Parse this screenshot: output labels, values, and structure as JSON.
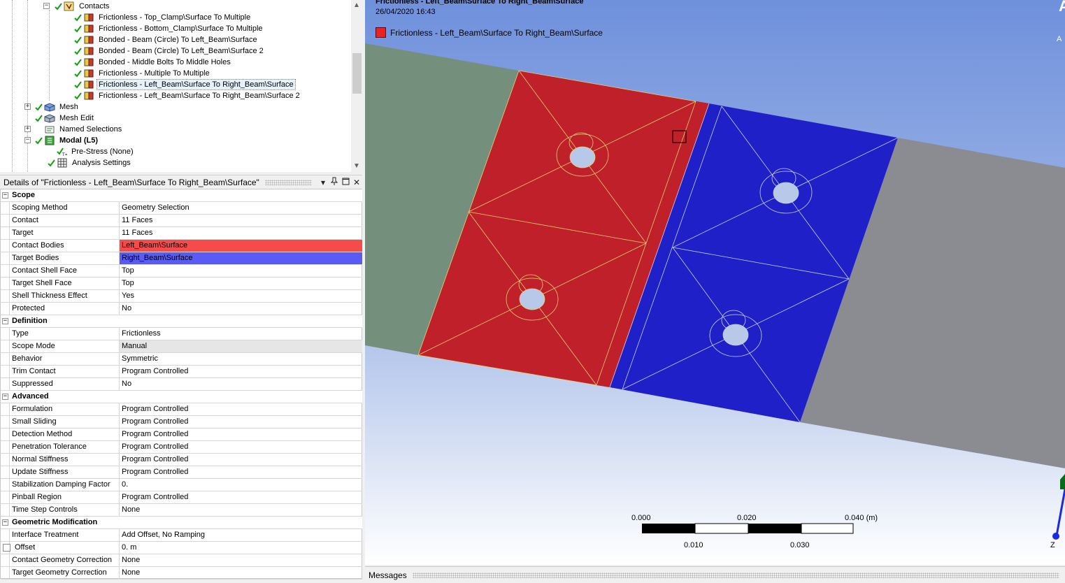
{
  "tree": {
    "items": [
      {
        "label": "Contacts",
        "kind": "folder"
      },
      {
        "label": "Frictionless - Top_Clamp\\Surface To Multiple"
      },
      {
        "label": "Frictionless - Bottom_Clamp\\Surface To Multiple"
      },
      {
        "label": "Bonded - Beam (Circle) To Left_Beam\\Surface"
      },
      {
        "label": "Bonded - Beam (Circle) To Left_Beam\\Surface 2"
      },
      {
        "label": "Bonded - Middle Bolts To Middle Holes"
      },
      {
        "label": "Frictionless - Multiple To Multiple"
      },
      {
        "label": "Frictionless - Left_Beam\\Surface To Right_Beam\\Surface",
        "selected": true
      },
      {
        "label": "Frictionless - Left_Beam\\Surface To Right_Beam\\Surface 2"
      },
      {
        "label": "Mesh"
      },
      {
        "label": "Mesh Edit"
      },
      {
        "label": "Named Selections"
      },
      {
        "label": "Modal (L5)",
        "bold": true
      },
      {
        "label": "Pre-Stress (None)"
      },
      {
        "label": "Analysis Settings"
      }
    ]
  },
  "details": {
    "title": "Details of \"Frictionless - Left_Beam\\Surface To Right_Beam\\Surface\"",
    "sections": [
      {
        "name": "Scope",
        "rows": [
          {
            "key": "Scoping Method",
            "value": "Geometry Selection"
          },
          {
            "key": "Contact",
            "value": "11 Faces"
          },
          {
            "key": "Target",
            "value": "11 Faces"
          },
          {
            "key": "Contact Bodies",
            "value": "Left_Beam\\Surface",
            "color": "#f54b4b"
          },
          {
            "key": "Target Bodies",
            "value": "Right_Beam\\Surface",
            "color": "#5a5af5"
          },
          {
            "key": "Contact Shell Face",
            "value": "Top"
          },
          {
            "key": "Target Shell Face",
            "value": "Top"
          },
          {
            "key": "Shell Thickness Effect",
            "value": "Yes"
          },
          {
            "key": "Protected",
            "value": "No"
          }
        ]
      },
      {
        "name": "Definition",
        "rows": [
          {
            "key": "Type",
            "value": "Frictionless"
          },
          {
            "key": "Scope Mode",
            "value": "Manual",
            "color": "#e6e6e6"
          },
          {
            "key": "Behavior",
            "value": "Symmetric"
          },
          {
            "key": "Trim Contact",
            "value": "Program Controlled"
          },
          {
            "key": "Suppressed",
            "value": "No"
          }
        ]
      },
      {
        "name": "Advanced",
        "rows": [
          {
            "key": "Formulation",
            "value": "Program Controlled"
          },
          {
            "key": "Small Sliding",
            "value": "Program Controlled"
          },
          {
            "key": "Detection Method",
            "value": "Program Controlled"
          },
          {
            "key": "Penetration Tolerance",
            "value": "Program Controlled"
          },
          {
            "key": "Normal Stiffness",
            "value": "Program Controlled"
          },
          {
            "key": "Update Stiffness",
            "value": "Program Controlled"
          },
          {
            "key": "Stabilization Damping Factor",
            "value": "0."
          },
          {
            "key": "Pinball Region",
            "value": "Program Controlled"
          },
          {
            "key": "Time Step Controls",
            "value": "None"
          }
        ]
      },
      {
        "name": "Geometric Modification",
        "rows": [
          {
            "key": "Interface Treatment",
            "value": "Add Offset, No Ramping"
          },
          {
            "key": "Offset",
            "value": "0. m",
            "checkbox": true
          },
          {
            "key": "Contact Geometry Correction",
            "value": "None"
          },
          {
            "key": "Target Geometry Correction",
            "value": "None"
          }
        ]
      }
    ]
  },
  "viewport": {
    "title": "Frictionless - Left_Beam\\Surface To Right_Beam\\Surface",
    "date": "26/04/2020 16:43",
    "legend_label": "Frictionless - Left_Beam\\Surface To Right_Beam\\Surface",
    "scale_top": [
      "0.000",
      "0.020",
      "0.040 (m)"
    ],
    "scale_bottom": [
      "0.010",
      "0.030"
    ],
    "logo": "A",
    "logo_small": "A",
    "axis_label": "Z"
  },
  "messages": {
    "title": "Messages"
  },
  "colors": {
    "contact": "#c0202a",
    "target": "#2020c8",
    "left_body": "#74907c",
    "right_body": "#8a8c92"
  },
  "icons": [
    "contacts-folder-icon",
    "contact-region-icon",
    "check-icon",
    "mesh-icon",
    "mesh-edit-icon",
    "named-selections-icon",
    "modal-icon",
    "pre-stress-icon",
    "analysis-settings-icon",
    "pin-icon",
    "maximize-icon",
    "close-icon",
    "dropdown-icon"
  ]
}
